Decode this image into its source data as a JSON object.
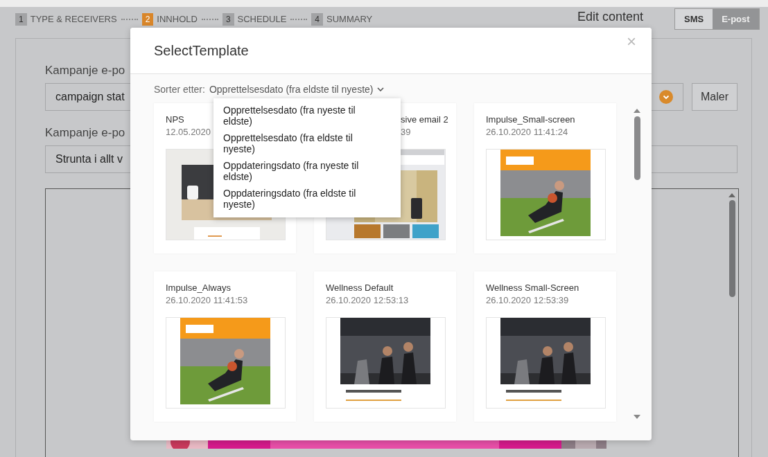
{
  "steps": [
    {
      "number": "1",
      "label": "TYPE & RECEIVERS",
      "selected": false
    },
    {
      "number": "2",
      "label": "INNHOLD",
      "selected": true
    },
    {
      "number": "3",
      "label": "SCHEDULE",
      "selected": false
    },
    {
      "number": "4",
      "label": "SUMMARY",
      "selected": false
    }
  ],
  "header": {
    "title": "Edit content",
    "channels": [
      {
        "label": "SMS",
        "selected": false
      },
      {
        "label": "E-post",
        "selected": true
      }
    ]
  },
  "form": {
    "fields": [
      {
        "label": "Kampanje e-po",
        "value": "campaign stat",
        "kind": "select",
        "button": "Maler"
      },
      {
        "label": "Kampanje e-po",
        "value": "Strunta i allt v",
        "kind": "text"
      }
    ]
  },
  "modal": {
    "title": "SelectTemplate",
    "close": "×",
    "sort": {
      "label": "Sorter etter:",
      "value": "Opprettelsesdato (fra eldste til nyeste)",
      "expanded": true,
      "options": [
        "Opprettelsesdato (fra nyeste til eldste)",
        "Opprettelsesdato (fra eldste til nyeste)",
        "Oppdateringsdato (fra nyeste til eldste)",
        "Oppdateringsdato (fra eldste til nyeste)"
      ]
    },
    "templates": [
      {
        "title": "NPS",
        "date": "12.05.2020"
      },
      {
        "title": "sive email 2",
        "date": "39"
      },
      {
        "title": "Impulse_Small-screen",
        "date": "26.10.2020 11:41:24"
      },
      {
        "title": "Impulse_Always",
        "date": "26.10.2020 11:41:53"
      },
      {
        "title": "Wellness Default",
        "date": "26.10.2020 12:53:13"
      },
      {
        "title": "Wellness Small-Screen",
        "date": "26.10.2020 12:53:39"
      }
    ]
  }
}
